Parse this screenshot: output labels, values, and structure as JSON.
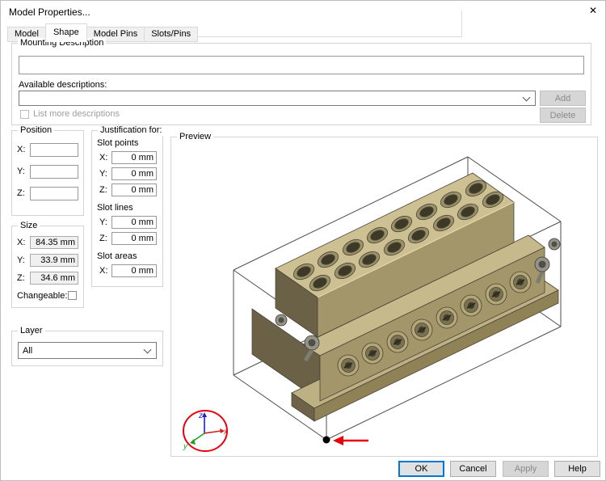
{
  "window": {
    "title": "Model Properties...",
    "close_glyph": "✕"
  },
  "tabs": [
    {
      "label": "Model",
      "active": false
    },
    {
      "label": "Shape",
      "active": true
    },
    {
      "label": "Model Pins",
      "active": false
    },
    {
      "label": "Slots/Pins",
      "active": false
    }
  ],
  "mounting": {
    "group_label": "Mounting Description",
    "description_value": "",
    "available_label": "Available descriptions:",
    "available_value": "",
    "add_label": "Add",
    "delete_label": "Delete",
    "add_enabled": false,
    "delete_enabled": false,
    "list_more_label": "List more descriptions",
    "list_more_checked": false
  },
  "position": {
    "group_label": "Position",
    "rows": [
      {
        "label": "X:",
        "value": ""
      },
      {
        "label": "Y:",
        "value": ""
      },
      {
        "label": "Z:",
        "value": ""
      }
    ]
  },
  "justification": {
    "group_label": "Justification for:",
    "sections": [
      {
        "title": "Slot points",
        "rows": [
          {
            "label": "X:",
            "value": "0 mm"
          },
          {
            "label": "Y:",
            "value": "0 mm"
          },
          {
            "label": "Z:",
            "value": "0 mm"
          }
        ]
      },
      {
        "title": "Slot lines",
        "rows": [
          {
            "label": "Y:",
            "value": "0 mm"
          },
          {
            "label": "Z:",
            "value": "0 mm"
          }
        ]
      },
      {
        "title": "Slot areas",
        "rows": [
          {
            "label": "X:",
            "value": "0 mm"
          }
        ]
      }
    ]
  },
  "size": {
    "group_label": "Size",
    "rows": [
      {
        "label": "X:",
        "value": "84.35 mm"
      },
      {
        "label": "Y:",
        "value": "33.9 mm"
      },
      {
        "label": "Z:",
        "value": "34.6 mm"
      }
    ],
    "changeable_label": "Changeable:",
    "changeable_checked": false
  },
  "layer": {
    "group_label": "Layer",
    "value": "All"
  },
  "preview": {
    "group_label": "Preview",
    "axis_labels": {
      "x": "x",
      "y": "y",
      "z": "z"
    }
  },
  "footer": {
    "ok": "OK",
    "cancel": "Cancel",
    "apply": "Apply",
    "help": "Help",
    "apply_enabled": false
  },
  "colors": {
    "accent": "#0078d7",
    "annotation_red": "#e8000d",
    "model_tan": "#a3966a",
    "axis_x": "#d11f1f",
    "axis_y": "#1fa01f",
    "axis_z": "#1f1fd1"
  }
}
